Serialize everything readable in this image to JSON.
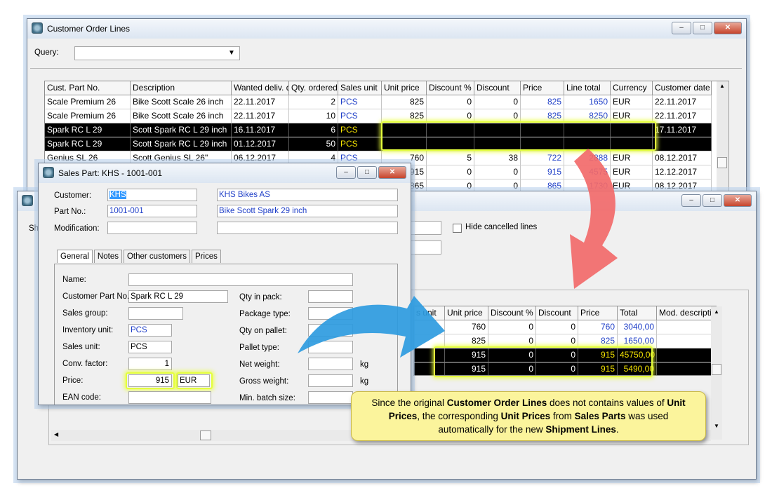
{
  "order_lines": {
    "title": "Customer Order Lines",
    "query_label": "Query:",
    "query_value": "",
    "columns": [
      "Cust. Part No.",
      "Description",
      "Wanted deliv. d",
      "Qty. ordered",
      "Sales unit",
      "Unit price",
      "Discount %",
      "Discount",
      "Price",
      "Line total",
      "Currency",
      "Customer date"
    ],
    "rows": [
      [
        "Scale Premium 26",
        "Bike Scott Scale 26 inch",
        "22.11.2017",
        "2",
        "PCS",
        "825",
        "0",
        "0",
        "825",
        "1650",
        "EUR",
        "22.11.2017"
      ],
      [
        "Scale Premium 26",
        "Bike Scott Scale 26 inch",
        "22.11.2017",
        "10",
        "PCS",
        "825",
        "0",
        "0",
        "825",
        "8250",
        "EUR",
        "22.11.2017"
      ],
      [
        "Spark RC L 29",
        "Scott Spark RC L 29 inch",
        "16.11.2017",
        "6",
        "PCS",
        "",
        "",
        "",
        "",
        "",
        "",
        "17.11.2017"
      ],
      [
        "Spark RC L 29",
        "Scott Spark RC L 29 inch",
        "01.12.2017",
        "50",
        "PCS",
        "",
        "",
        "",
        "",
        "",
        "",
        ""
      ],
      [
        "Genius SL 26",
        "Scott Genius SL 26\"",
        "06.12.2017",
        "4",
        "PCS",
        "760",
        "5",
        "38",
        "722",
        "2888",
        "EUR",
        "08.12.2017"
      ],
      [
        "",
        "",
        "",
        "",
        "",
        "915",
        "0",
        "0",
        "915",
        "4575",
        "EUR",
        "12.12.2017"
      ],
      [
        "",
        "",
        "",
        "",
        "",
        "865",
        "0",
        "0",
        "865",
        "1730",
        "EUR",
        "08.12.2017"
      ]
    ]
  },
  "shipment": {
    "hide_cancelled_label": "Hide cancelled lines",
    "partial_label": "Sh",
    "columns": [
      "s unit",
      "Unit price",
      "Discount %",
      "Discount",
      "Price",
      "Total",
      "Mod. descriptio"
    ],
    "rows": [
      [
        "",
        "760",
        "0",
        "0",
        "760",
        "3040,00",
        ""
      ],
      [
        "",
        "825",
        "0",
        "0",
        "825",
        "1650,00",
        ""
      ],
      [
        "",
        "915",
        "0",
        "0",
        "915",
        "45750,00",
        ""
      ],
      [
        "",
        "915",
        "0",
        "0",
        "915",
        "5490,00",
        ""
      ]
    ]
  },
  "sales_part": {
    "title": "Sales Part: KHS - 1001-001",
    "customer_label": "Customer:",
    "customer_value": "KHS",
    "customer_name": "KHS Bikes AS",
    "partno_label": "Part No.:",
    "partno_value": "1001-001",
    "partno_desc": "Bike Scott Spark 29 inch",
    "modification_label": "Modification:",
    "tabs": [
      "General",
      "Notes",
      "Other customers",
      "Prices"
    ],
    "left_labels": [
      "Name:",
      "Customer Part No.:",
      "Sales group:",
      "Inventory unit:",
      "Sales unit:",
      "Conv. factor:",
      "Price:",
      "EAN code:"
    ],
    "left_values": [
      "",
      "Spark RC L 29",
      "",
      "PCS",
      "PCS",
      "1",
      "915",
      ""
    ],
    "price_currency": "EUR",
    "right_labels": [
      "Qty in pack:",
      "Package type:",
      "Qty on pallet:",
      "Pallet type:",
      "Net weight:",
      "Gross weight:",
      "Min. batch size:"
    ],
    "unit_kg_1": "kg",
    "unit_kg_2": "kg"
  },
  "callout": {
    "t1": "Since the original ",
    "b1": "Customer Order Lines",
    "t2": " does not contains values of ",
    "b2": "Unit Prices",
    "t3": ", the corresponding ",
    "b3": "Unit Prices",
    "t4": " from ",
    "b4": "Sales Parts",
    "t5": " was used automatically for the new ",
    "b5": "Shipment Lines",
    "t6": "."
  },
  "colors": {
    "highlight": "#e4ff3c",
    "callout_bg": "#fbf49c",
    "red_arrow": "#f26a6a",
    "blue_arrow": "#2e9be0"
  }
}
